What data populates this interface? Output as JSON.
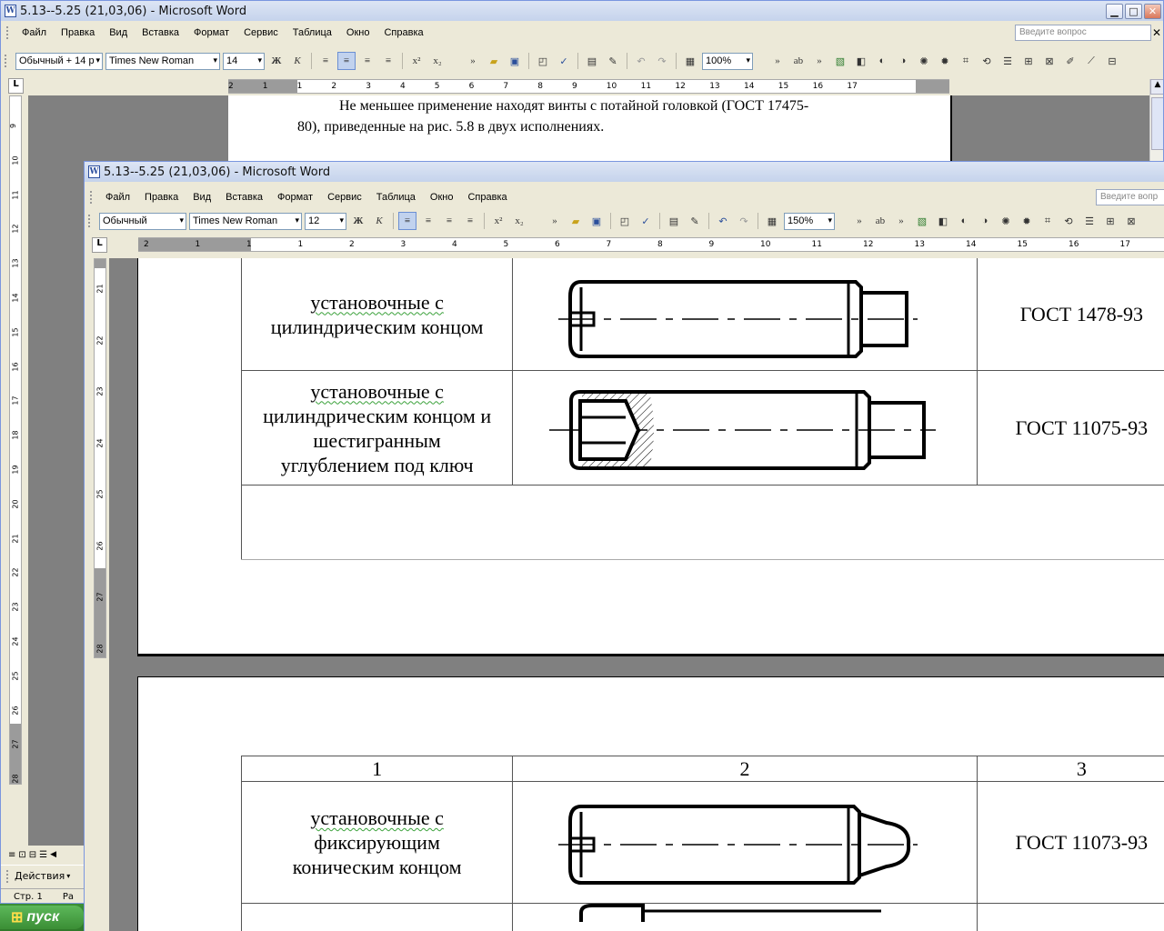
{
  "back_window": {
    "title": "5.13--5.25 (21,03,06) - Microsoft Word",
    "menu": [
      "Файл",
      "Правка",
      "Вид",
      "Вставка",
      "Формат",
      "Сервис",
      "Таблица",
      "Окно",
      "Справка"
    ],
    "ask_placeholder": "Введите вопрос",
    "style": "Обычный + 14 р",
    "font": "Times New Roman",
    "size": "14",
    "zoom": "100%",
    "ruler_labels": [
      "2",
      "1",
      "1",
      "2",
      "3",
      "4",
      "5",
      "6",
      "7",
      "8",
      "9",
      "10",
      "11",
      "12",
      "13",
      "14",
      "15",
      "16",
      "17"
    ],
    "vruler_labels": [
      "9",
      "10",
      "11",
      "12",
      "13",
      "14",
      "15",
      "16",
      "17",
      "18",
      "19",
      "20",
      "21",
      "22",
      "23",
      "24",
      "25",
      "26",
      "27",
      "28"
    ],
    "doc_line1": "Не меньшее применение находят винты с потайной головкой (ГОСТ 17475-",
    "doc_line2": "80), приведенные на рис. 5.8 в двух исполнениях.",
    "draw_menu": "Действия",
    "status_page": "Стр. 1",
    "status_trunc": "Ра"
  },
  "front_window": {
    "title": "5.13--5.25 (21,03,06) - Microsoft Word",
    "menu": [
      "Файл",
      "Правка",
      "Вид",
      "Вставка",
      "Формат",
      "Сервис",
      "Таблица",
      "Окно",
      "Справка"
    ],
    "ask_placeholder": "Введите вопр",
    "style": "Обычный",
    "font": "Times New Roman",
    "size": "12",
    "zoom": "150%",
    "ruler_labels": [
      "2",
      "1",
      "1",
      "1",
      "2",
      "3",
      "4",
      "5",
      "6",
      "7",
      "8",
      "9",
      "10",
      "11",
      "12",
      "13",
      "14",
      "15",
      "16",
      "17"
    ],
    "vruler_labels": [
      "21",
      "22",
      "23",
      "24",
      "25",
      "26",
      "27",
      "28"
    ]
  },
  "table_top": [
    {
      "line1": "установочные с",
      "line2": "цилиндрическим концом",
      "gost": "ГОСТ 1478-93"
    },
    {
      "line1": "установочные с",
      "line2": "цилиндрическим концом и",
      "line3": "шестигранным",
      "line4": "углублением под ключ",
      "gost": "ГОСТ 11075-93"
    }
  ],
  "table_bottom": {
    "headers": [
      "1",
      "2",
      "3"
    ],
    "row": {
      "line1": "установочные с",
      "line2": "фиксирующим",
      "line3": "коническим концом",
      "gost": "ГОСТ 11073-93"
    }
  },
  "taskbar": {
    "start": "пуск"
  }
}
